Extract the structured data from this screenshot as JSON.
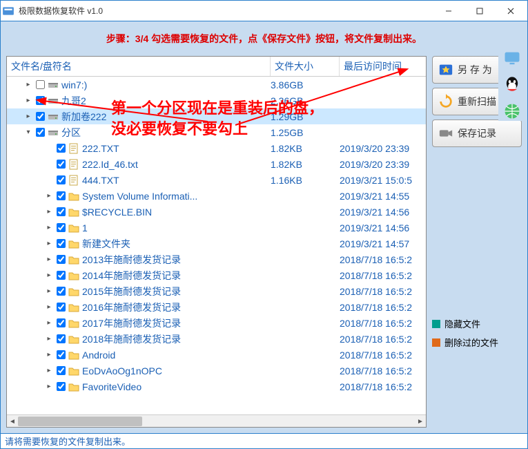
{
  "window": {
    "title": "极限数据恢复软件 v1.0"
  },
  "instruction": "步骤：3/4 勾选需要恢复的文件，点《保存文件》按钮，将文件复制出来。",
  "columns": {
    "name": "文件名/盘符名",
    "size": "文件大小",
    "time": "最后访问时间"
  },
  "rows": [
    {
      "indent": 0,
      "exp": "▸",
      "chk": false,
      "icon": "drive",
      "name": "win7:)",
      "size": "3.86GB",
      "time": ""
    },
    {
      "indent": 0,
      "exp": "▸",
      "chk": true,
      "icon": "drive",
      "name": "九哥2",
      "size": "2.36GB",
      "time": ""
    },
    {
      "indent": 0,
      "exp": "▸",
      "chk": true,
      "icon": "drive",
      "name": "新加卷222",
      "size": "1.29GB",
      "time": "",
      "selected": true
    },
    {
      "indent": 0,
      "exp": "▾",
      "chk": true,
      "icon": "drive",
      "name": "分区",
      "size": "1.25GB",
      "time": ""
    },
    {
      "indent": 1,
      "exp": "",
      "chk": true,
      "icon": "txt",
      "name": "222.TXT",
      "size": "1.82KB",
      "time": "2019/3/20 23:39"
    },
    {
      "indent": 1,
      "exp": "",
      "chk": true,
      "icon": "txt",
      "name": "222.Id_46.txt",
      "size": "1.82KB",
      "time": "2019/3/20 23:39"
    },
    {
      "indent": 1,
      "exp": "",
      "chk": true,
      "icon": "txt",
      "name": "444.TXT",
      "size": "1.16KB",
      "time": "2019/3/21 15:0:5"
    },
    {
      "indent": 1,
      "exp": "▸",
      "chk": true,
      "icon": "folder",
      "name": "System Volume Informati...",
      "size": "",
      "time": "2019/3/21 14:55"
    },
    {
      "indent": 1,
      "exp": "▸",
      "chk": true,
      "icon": "folder",
      "name": "$RECYCLE.BIN",
      "size": "",
      "time": "2019/3/21 14:56"
    },
    {
      "indent": 1,
      "exp": "▸",
      "chk": true,
      "icon": "folder",
      "name": "1",
      "size": "",
      "time": "2019/3/21 14:56"
    },
    {
      "indent": 1,
      "exp": "▸",
      "chk": true,
      "icon": "folder",
      "name": "新建文件夹",
      "size": "",
      "time": "2019/3/21 14:57"
    },
    {
      "indent": 1,
      "exp": "▸",
      "chk": true,
      "icon": "folder",
      "name": "2013年施耐德发货记录",
      "size": "",
      "time": "2018/7/18 16:5:2"
    },
    {
      "indent": 1,
      "exp": "▸",
      "chk": true,
      "icon": "folder",
      "name": "2014年施耐德发货记录",
      "size": "",
      "time": "2018/7/18 16:5:2"
    },
    {
      "indent": 1,
      "exp": "▸",
      "chk": true,
      "icon": "folder",
      "name": "2015年施耐德发货记录",
      "size": "",
      "time": "2018/7/18 16:5:2"
    },
    {
      "indent": 1,
      "exp": "▸",
      "chk": true,
      "icon": "folder",
      "name": "2016年施耐德发货记录",
      "size": "",
      "time": "2018/7/18 16:5:2"
    },
    {
      "indent": 1,
      "exp": "▸",
      "chk": true,
      "icon": "folder",
      "name": "2017年施耐德发货记录",
      "size": "",
      "time": "2018/7/18 16:5:2"
    },
    {
      "indent": 1,
      "exp": "▸",
      "chk": true,
      "icon": "folder",
      "name": "2018年施耐德发货记录",
      "size": "",
      "time": "2018/7/18 16:5:2"
    },
    {
      "indent": 1,
      "exp": "▸",
      "chk": true,
      "icon": "folder",
      "name": "Android",
      "size": "",
      "time": "2018/7/18 16:5:2"
    },
    {
      "indent": 1,
      "exp": "▸",
      "chk": true,
      "icon": "folder",
      "name": "EoDvAoOg1nOPC",
      "size": "",
      "time": "2018/7/18 16:5:2"
    },
    {
      "indent": 1,
      "exp": "▸",
      "chk": true,
      "icon": "folder",
      "name": "FavoriteVideo",
      "size": "",
      "time": "2018/7/18 16:5:2"
    }
  ],
  "side": {
    "save_as": "另 存 为",
    "rescan": "重新扫描",
    "save_log": "保存记录"
  },
  "legend": {
    "hidden": "隐藏文件",
    "deleted": "删除过的文件",
    "hidden_color": "#009e8e",
    "deleted_color": "#e06a1a"
  },
  "status": "请将需要恢复的文件复制出来。",
  "annotations": {
    "line1": "第一个分区现在是重装后的盘，",
    "line2": "没必要恢复不要勾上"
  }
}
